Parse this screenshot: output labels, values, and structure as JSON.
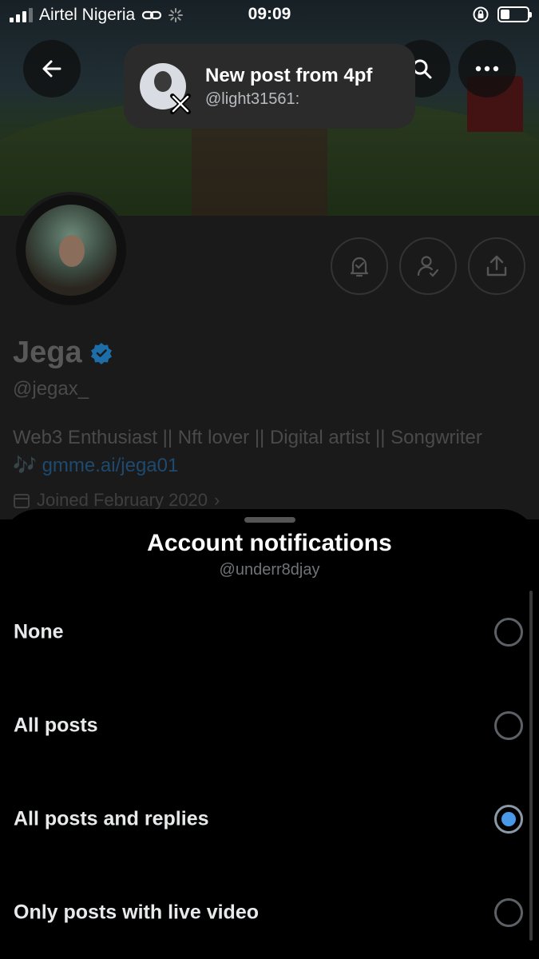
{
  "status_bar": {
    "carrier": "Airtel Nigeria",
    "time": "09:09",
    "battery_level": 0.35
  },
  "toast": {
    "title": "New post from 4pf",
    "subtitle": "@light31561:",
    "icon": "x-logo-icon"
  },
  "profile": {
    "name": "Jega",
    "handle": "@jegax_",
    "bio": "Web3 Enthusiast || Nft lover || Digital artist || Songwriter",
    "bio_emoji": "🎶",
    "link": "gmme.ai/jega01",
    "joined": "Joined February 2020",
    "verified_color": "#1d9bf0"
  },
  "sheet": {
    "title": "Account notifications",
    "subtitle": "@underr8djay",
    "options": [
      {
        "label": "None",
        "selected": false
      },
      {
        "label": "All posts",
        "selected": false
      },
      {
        "label": "All posts and replies",
        "selected": true
      },
      {
        "label": "Only posts with live video",
        "selected": false
      }
    ]
  },
  "colors": {
    "accent": "#4a99e9",
    "background": "#000000"
  }
}
